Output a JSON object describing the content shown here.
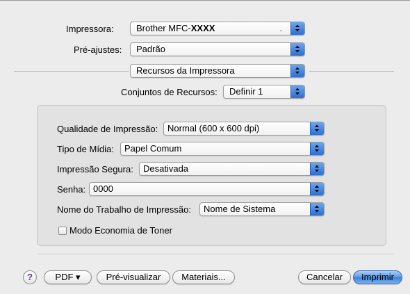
{
  "printer": {
    "label": "Impressora:",
    "value": "Brother MFC-",
    "value_bold": "XXXX",
    "extra": "."
  },
  "presets": {
    "label": "Pré-ajustes:",
    "value": "Padrão"
  },
  "section": {
    "value": "Recursos da Impressora"
  },
  "feature_sets": {
    "label": "Conjuntos de Recursos:",
    "value": "Definir 1"
  },
  "options": {
    "print_quality": {
      "label": "Qualidade de Impressão:",
      "value": "Normal (600 x 600 dpi)"
    },
    "media_type": {
      "label": "Tipo de Mídia:",
      "value": "Papel Comum"
    },
    "secure_print": {
      "label": "Impressão Segura:",
      "value": "Desativada"
    },
    "password": {
      "label": "Senha:",
      "value": "0000"
    },
    "job_name": {
      "label": "Nome do Trabalho de Impressão:",
      "value": "Nome de Sistema"
    },
    "toner_save": {
      "label": "Modo Economia de Toner",
      "checked": false
    }
  },
  "footer": {
    "help": "?",
    "pdf": "PDF ▾",
    "preview": "Pré-visualizar",
    "supplies": "Materiais...",
    "cancel": "Cancelar",
    "print": "Imprimir"
  },
  "colors": {
    "accent": "#3c80dc",
    "window_bg": "#ececec",
    "group_bg": "#e2e2e2"
  }
}
